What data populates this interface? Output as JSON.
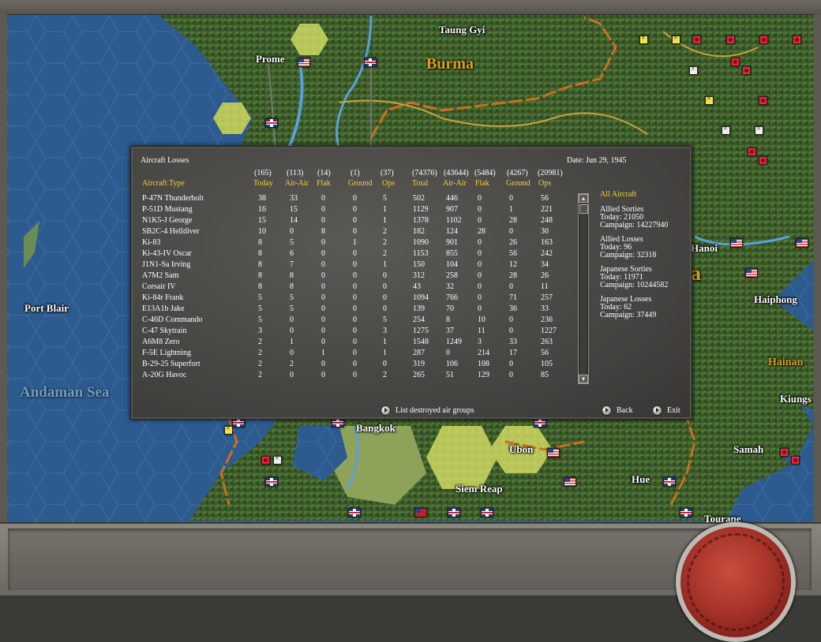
{
  "map": {
    "cities": [
      {
        "name": "Taung Gyi"
      },
      {
        "name": "Prome"
      },
      {
        "name": "Port Blair"
      },
      {
        "name": "Hanoi"
      },
      {
        "name": "Haiphong"
      },
      {
        "name": "Kiungs"
      },
      {
        "name": "Bangkok"
      },
      {
        "name": "Ubon"
      },
      {
        "name": "Samah"
      },
      {
        "name": "Siem Reap"
      },
      {
        "name": "Hue"
      },
      {
        "name": "Tourane"
      }
    ],
    "regions": [
      {
        "name": "Burma"
      },
      {
        "name": "Hainan"
      },
      {
        "name": "a"
      }
    ],
    "seas": [
      {
        "name": "Andaman Sea"
      }
    ]
  },
  "dialog": {
    "title": "Aircraft Losses",
    "date": "Date: Jun 29, 1945",
    "columns": [
      {
        "total": "(165)",
        "name": "Today"
      },
      {
        "total": "(113)",
        "name": "Air-Air"
      },
      {
        "total": "(14)",
        "name": "Flak"
      },
      {
        "total": "(1)",
        "name": "Ground"
      },
      {
        "total": "(37)",
        "name": "Ops"
      },
      {
        "total": "(74376)",
        "name": "Total"
      },
      {
        "total": "(43644)",
        "name": "Air-Air"
      },
      {
        "total": "(5484)",
        "name": "Flak"
      },
      {
        "total": "(4267)",
        "name": "Ground"
      },
      {
        "total": "(20981)",
        "name": "Ops"
      }
    ],
    "type_header": "Aircraft Type",
    "rows": [
      {
        "type": "P-47N Thunderbolt",
        "vals": [
          "38",
          "33",
          "0",
          "0",
          "5",
          "502",
          "446",
          "0",
          "0",
          "56"
        ]
      },
      {
        "type": "P-51D Mustang",
        "vals": [
          "16",
          "15",
          "0",
          "0",
          "1",
          "1129",
          "907",
          "0",
          "1",
          "221"
        ]
      },
      {
        "type": "N1K5-J George",
        "vals": [
          "15",
          "14",
          "0",
          "0",
          "1",
          "1378",
          "1102",
          "0",
          "28",
          "248"
        ]
      },
      {
        "type": "SB2C-4 Helldiver",
        "vals": [
          "10",
          "0",
          "8",
          "0",
          "2",
          "182",
          "124",
          "28",
          "0",
          "30"
        ]
      },
      {
        "type": "Ki-83",
        "vals": [
          "8",
          "5",
          "0",
          "1",
          "2",
          "1090",
          "901",
          "0",
          "26",
          "163"
        ]
      },
      {
        "type": "Ki-43-IV Oscar",
        "vals": [
          "8",
          "6",
          "0",
          "0",
          "2",
          "1153",
          "855",
          "0",
          "56",
          "242"
        ]
      },
      {
        "type": "J1N1-Sa Irving",
        "vals": [
          "8",
          "7",
          "0",
          "0",
          "1",
          "150",
          "104",
          "0",
          "12",
          "34"
        ]
      },
      {
        "type": "A7M2 Sam",
        "vals": [
          "8",
          "8",
          "0",
          "0",
          "0",
          "312",
          "258",
          "0",
          "28",
          "26"
        ]
      },
      {
        "type": "Corsair IV",
        "vals": [
          "8",
          "8",
          "0",
          "0",
          "0",
          "43",
          "32",
          "0",
          "0",
          "11"
        ]
      },
      {
        "type": "Ki-84r Frank",
        "vals": [
          "5",
          "5",
          "0",
          "0",
          "0",
          "1094",
          "766",
          "0",
          "71",
          "257"
        ]
      },
      {
        "type": "E13A1b Jake",
        "vals": [
          "5",
          "5",
          "0",
          "0",
          "0",
          "139",
          "70",
          "0",
          "36",
          "33"
        ]
      },
      {
        "type": "C-46D Commando",
        "vals": [
          "5",
          "0",
          "0",
          "0",
          "5",
          "254",
          "8",
          "10",
          "0",
          "236"
        ]
      },
      {
        "type": "C-47 Skytrain",
        "vals": [
          "3",
          "0",
          "0",
          "0",
          "3",
          "1275",
          "37",
          "11",
          "0",
          "1227"
        ]
      },
      {
        "type": "A6M8 Zero",
        "vals": [
          "2",
          "1",
          "0",
          "0",
          "1",
          "1548",
          "1249",
          "3",
          "33",
          "263"
        ]
      },
      {
        "type": "F-5E Lightning",
        "vals": [
          "2",
          "0",
          "1",
          "0",
          "1",
          "287",
          "0",
          "214",
          "17",
          "56"
        ]
      },
      {
        "type": "B-29-25 Superfort",
        "vals": [
          "2",
          "2",
          "0",
          "0",
          "0",
          "319",
          "106",
          "108",
          "0",
          "105"
        ]
      },
      {
        "type": "A-20G Havoc",
        "vals": [
          "2",
          "0",
          "0",
          "0",
          "2",
          "265",
          "51",
          "129",
          "0",
          "85"
        ]
      }
    ],
    "side": {
      "heading": "All Aircraft",
      "allied_sorties": {
        "title": "Allied Sorties",
        "today": "Today:   21050",
        "campaign": "Campaign: 14227940"
      },
      "allied_losses": {
        "title": "Allied Losses",
        "today": "Today:   96",
        "campaign": "Campaign: 32318"
      },
      "japanese_sorties": {
        "title": "Japanese Sorties",
        "today": "Today:   11971",
        "campaign": "Campaign: 10244582"
      },
      "japanese_losses": {
        "title": "Japanese Losses",
        "today": "Today:   62",
        "campaign": "Campaign: 37449"
      }
    },
    "buttons": {
      "list_destroyed": "List destroyed air groups",
      "back": "Back",
      "exit": "Exit"
    }
  }
}
